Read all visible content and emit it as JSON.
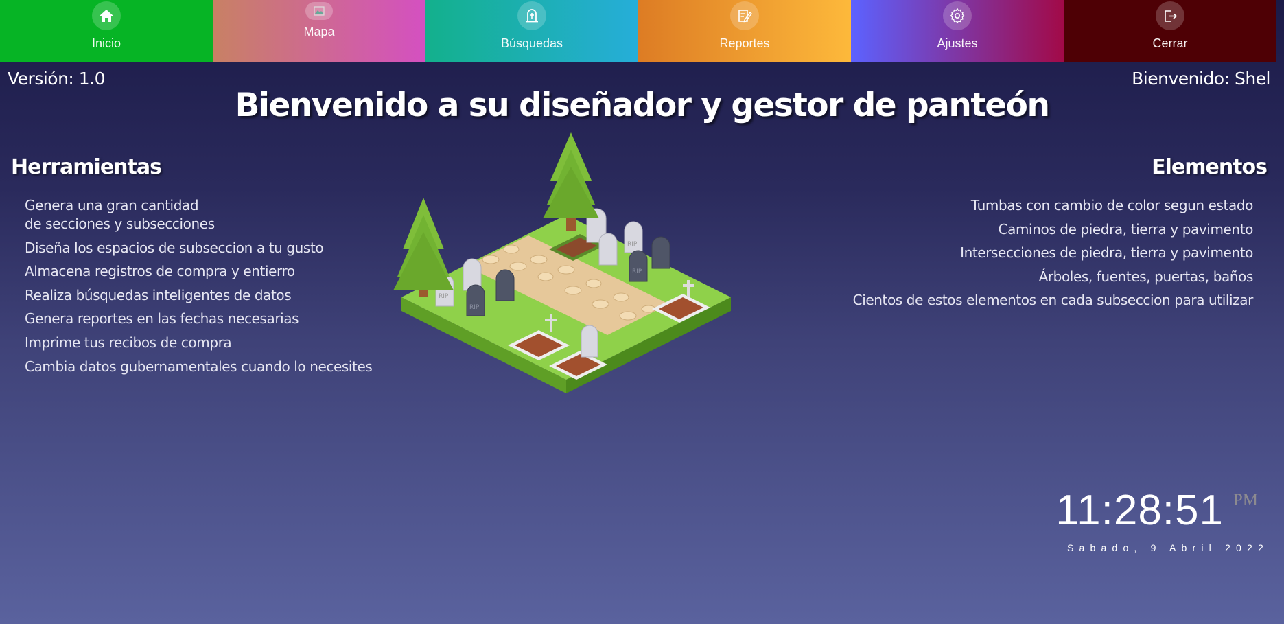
{
  "nav": {
    "items": [
      {
        "label": "Inicio",
        "icon": "home-icon"
      },
      {
        "label": "Mapa",
        "icon": "broken-image-icon"
      },
      {
        "label": "Búsquedas",
        "icon": "tombstone-icon"
      },
      {
        "label": "Reportes",
        "icon": "report-edit-icon"
      },
      {
        "label": "Ajustes",
        "icon": "gear-icon"
      },
      {
        "label": "Cerrar",
        "icon": "logout-icon"
      }
    ]
  },
  "header": {
    "version": "Versión: 1.0",
    "welcome_user": "Bienvenido: Shel",
    "title": "Bienvenido a su diseñador y gestor de panteón"
  },
  "tools": {
    "title": "Herramientas",
    "items": [
      "Genera una gran cantidad",
      "de secciones y subsecciones",
      "Diseña los espacios de subseccion a tu gusto",
      "Almacena registros de compra y entierro",
      "Realiza búsquedas inteligentes de datos",
      "Genera reportes en las fechas necesarias",
      "Imprime tus recibos de compra",
      "Cambia datos gubernamentales cuando lo necesites"
    ]
  },
  "elements": {
    "title": "Elementos",
    "items": [
      "Tumbas con cambio de color segun estado",
      "Caminos de piedra, tierra y pavimento",
      "Intersecciones de piedra, tierra y pavimento",
      "Árboles, fuentes, puertas, baños",
      "Cientos de estos elementos en cada subseccion para utilizar"
    ]
  },
  "clock": {
    "time": "11:28:51",
    "ampm": "PM",
    "date": "Sabado, 9 Abril 2022"
  },
  "illustration": {
    "grave_text": "RIP"
  }
}
